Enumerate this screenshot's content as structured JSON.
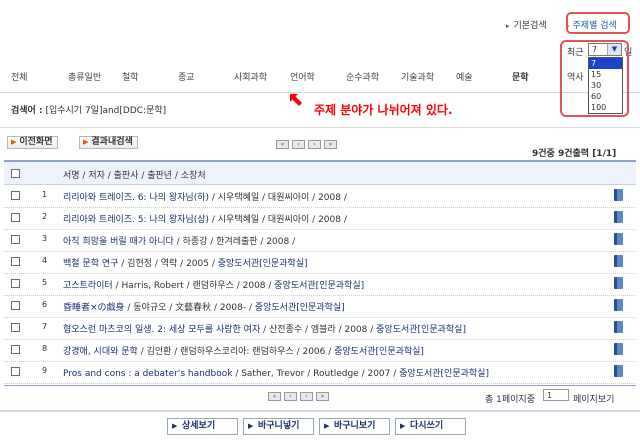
{
  "top_links": {
    "basic": "기본검색",
    "subject": "주제별 검색"
  },
  "categories": [
    "전체",
    "총류일반",
    "철학",
    "종교",
    "사회과학",
    "언어학",
    "순수과학",
    "기술과학",
    "예술",
    "문학",
    "역사"
  ],
  "recent": {
    "label": "최근",
    "selected": "7",
    "options": [
      "7",
      "15",
      "30",
      "60",
      "100"
    ],
    "tail": "일"
  },
  "annotation": "주제 분야가 나뉘어져 있다.",
  "search_term": {
    "label": "검색어 :",
    "value": "[입수시기 7일]and[DDC:문학]"
  },
  "buttons": {
    "prev": "이전화면",
    "within": "결과내검색"
  },
  "result_count": "9건중 9건출력 [1/1]",
  "table": {
    "header": "서명 / 저자 / 출판사 / 출판년 / 소장처",
    "rows": [
      {
        "num": "1",
        "title": "리리아와 트레이즈. 6: 나의 왕자님(하)",
        "rest": " / 시우택혜일 / 대원씨아이 / 2008 /",
        "lib": ""
      },
      {
        "num": "2",
        "title": "리리아와 트레이즈. 5: 나의 왕자님(상)",
        "rest": " / 시우택혜일 / 대원씨아이 / 2008 /",
        "lib": ""
      },
      {
        "num": "3",
        "title": "아직 희망을 버릴 때가 아니다",
        "rest": " / 하종강 / 한겨레출판 / 2008 /",
        "lib": ""
      },
      {
        "num": "4",
        "title": "백철 문학 연구",
        "rest": " / 김현정 / 역락 / 2005 / ",
        "lib": "중앙도서관[인문과학실]"
      },
      {
        "num": "5",
        "title": "고스트라이터",
        "rest": " / Harris, Robert / 랜덤하우스 / 2008 / ",
        "lib": "중앙도서관[인문과학실]"
      },
      {
        "num": "6",
        "title": "昏睡者×の戱身",
        "rest": " / 동야규오 / 文藝春秋 / 2008- / ",
        "lib": "중앙도서관[인문과학실]"
      },
      {
        "num": "7",
        "title": "혐오스런 마츠코의 일생. 2: 세상 모두를 사랑한 여자",
        "rest": " / 산전종수 / 엠블라 / 2008 / ",
        "lib": "중앙도서관[인문과학실]"
      },
      {
        "num": "8",
        "title": "강경애, 시대와 문학",
        "rest": " / 김인환 / 랜덤하우스코리아: 랜덤하우스 / 2006 / ",
        "lib": "중앙도서관[인문과학실]"
      },
      {
        "num": "9",
        "title": "Pros and cons : a debater's handbook",
        "rest": " / Sather, Trevor / Routledge / 2007 / ",
        "lib": "중앙도서관[인문과학실]"
      }
    ]
  },
  "pagination": {
    "total": "총 1페이지중",
    "page": "1",
    "suffix": "페이지보기"
  },
  "footer_buttons": [
    "상세보기",
    "바구니넣기",
    "바구니보기",
    "다시쓰기"
  ]
}
